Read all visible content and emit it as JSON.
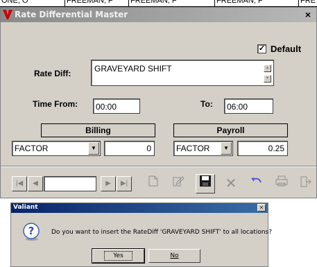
{
  "background": {
    "cells": [
      "ONE, O",
      "FREEMAN, F",
      "FREEMAN, F",
      "FREEMAN, F",
      "FRE"
    ]
  },
  "window": {
    "title": "Rate Differential Master",
    "close_glyph": "×",
    "default_checked_glyph": "✓",
    "default_label": "Default",
    "rate_diff_label": "Rate Diff:",
    "rate_diff_value": "GRAVEYARD SHIFT",
    "time_from_label": "Time From:",
    "time_from_value": "00:00",
    "to_label": "To:",
    "to_value": "06:00",
    "billing": {
      "label": "Billing",
      "type": "FACTOR",
      "value": "0"
    },
    "payroll": {
      "label": "Payroll",
      "type": "FACTOR",
      "value": "0.25"
    },
    "nav_value": ""
  },
  "dialog": {
    "title": "Valiant",
    "message": "Do you want to insert the RateDiff 'GRAVEYARD SHIFT' to all locations?",
    "yes_label": "Yes",
    "no_label": "No",
    "close_glyph": "×"
  },
  "colors": {
    "face": "#d4d0c8",
    "title_gray": "#9a9a9a",
    "dialog_title_blue": "#0a246a",
    "logo_red": "#cc0000"
  }
}
